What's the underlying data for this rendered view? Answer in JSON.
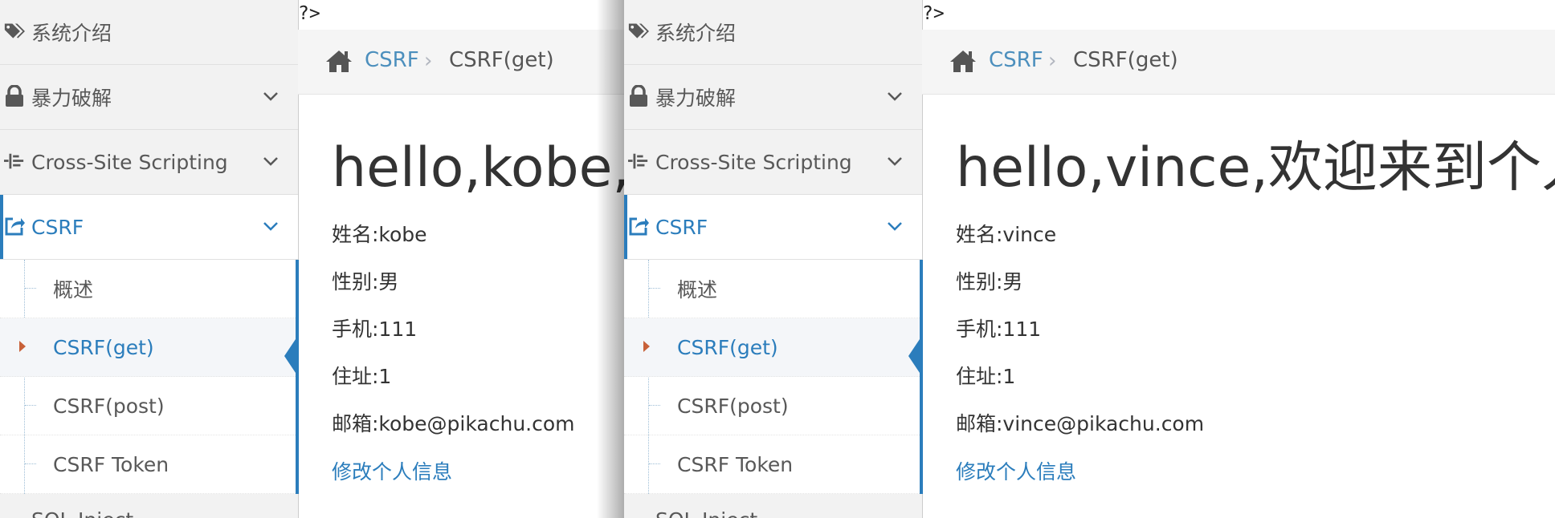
{
  "code_leak": "?>",
  "sidebar": {
    "items": [
      {
        "label": "系统介绍",
        "icon": "tags-icon"
      },
      {
        "label": "暴力破解",
        "icon": "lock-icon"
      },
      {
        "label": "Cross-Site Scripting",
        "icon": "align-left-icon"
      },
      {
        "label": "CSRF",
        "icon": "share-square-icon",
        "active": true
      }
    ],
    "sub_items": [
      {
        "label": "概述"
      },
      {
        "label": "CSRF(get)",
        "active": true
      },
      {
        "label": "CSRF(post)"
      },
      {
        "label": "CSRF Token"
      }
    ],
    "partial_item": {
      "label": "SQL-Inject"
    }
  },
  "breadcrumbs": {
    "parent": "CSRF",
    "current": "CSRF(get)"
  },
  "panels": [
    {
      "greeting": "hello,kobe,欢迎来到个人会员中心",
      "name": "姓名:kobe",
      "gender": "性别:男",
      "phone": "手机:111",
      "address": "住址:1",
      "email": "邮箱:kobe@pikachu.com",
      "edit_link": "修改个人信息"
    },
    {
      "greeting": "hello,vince,欢迎来到个人会员中心",
      "name": "姓名:vince",
      "gender": "性别:男",
      "phone": "手机:111",
      "address": "住址:1",
      "email": "邮箱:vince@pikachu.com",
      "edit_link": "修改个人信息"
    }
  ],
  "colors": {
    "accent": "#2b7dbc",
    "caret": "#c86139",
    "sidebar_bg": "#f2f2f2"
  }
}
